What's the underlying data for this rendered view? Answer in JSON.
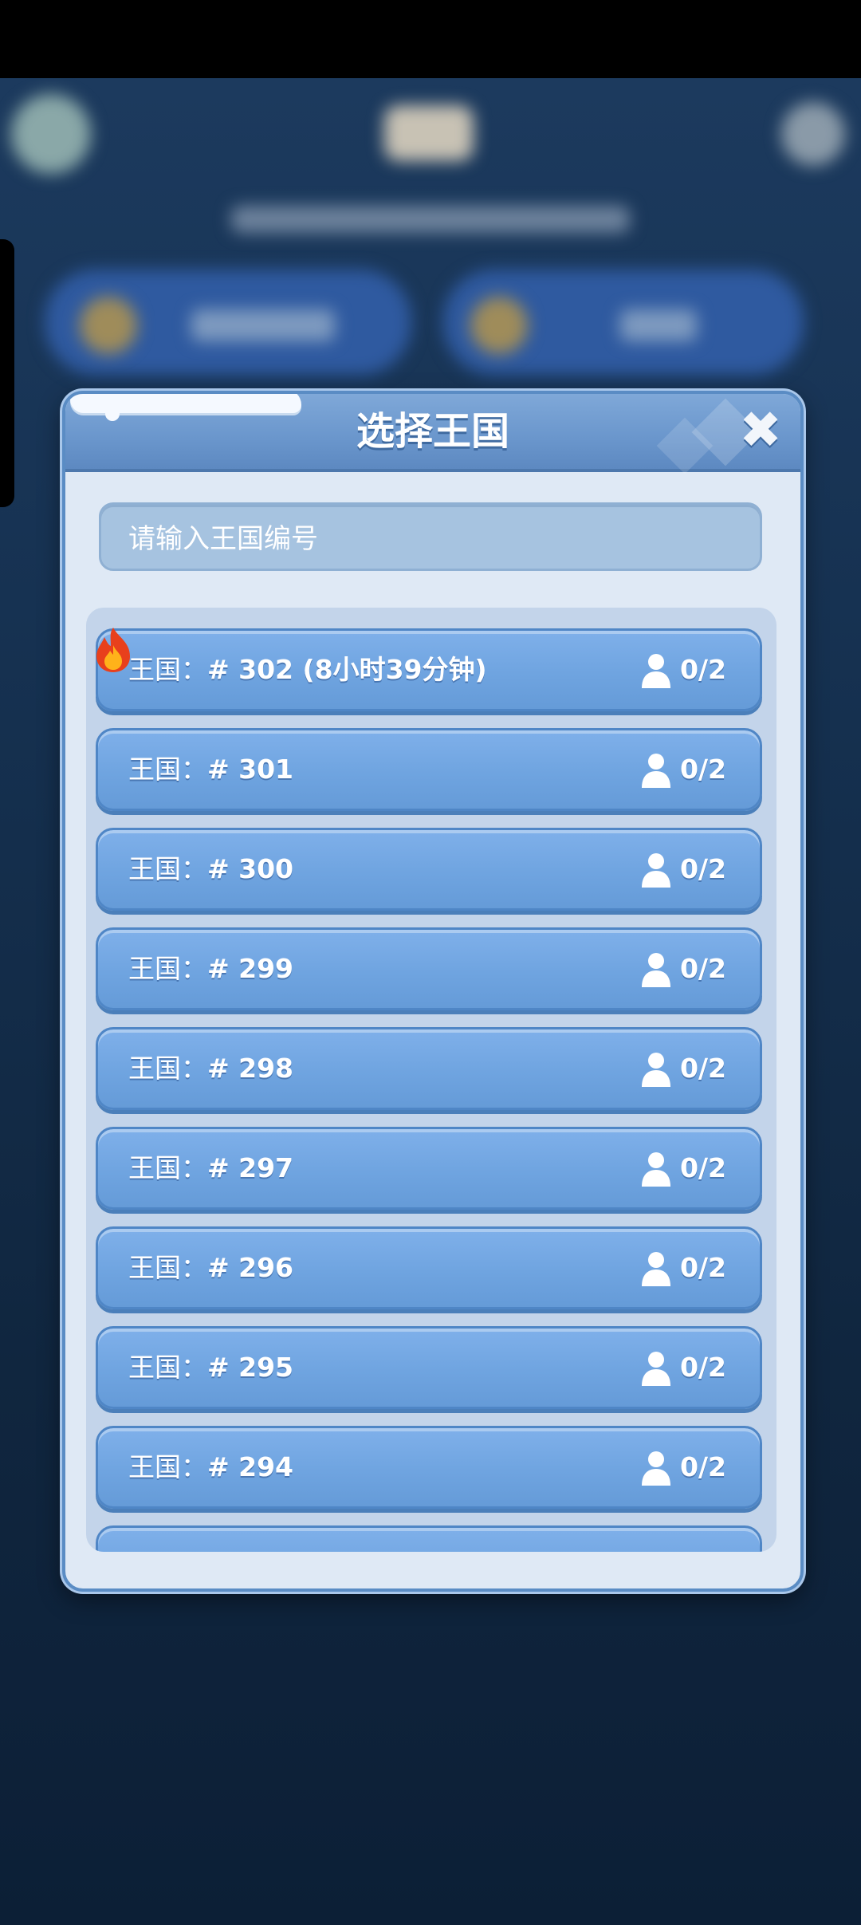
{
  "modal": {
    "title": "选择王国",
    "close_symbol": "✖",
    "search": {
      "placeholder": "请输入王国编号",
      "value": ""
    }
  },
  "kingdoms": [
    {
      "prefix": "王国：",
      "number": "# 302",
      "extra": " (8小时39分钟)",
      "count": "0/2",
      "hot": true
    },
    {
      "prefix": "王国：",
      "number": "# 301",
      "extra": "",
      "count": "0/2",
      "hot": false
    },
    {
      "prefix": "王国：",
      "number": "# 300",
      "extra": "",
      "count": "0/2",
      "hot": false
    },
    {
      "prefix": "王国：",
      "number": "# 299",
      "extra": "",
      "count": "0/2",
      "hot": false
    },
    {
      "prefix": "王国：",
      "number": "# 298",
      "extra": "",
      "count": "0/2",
      "hot": false
    },
    {
      "prefix": "王国：",
      "number": "# 297",
      "extra": "",
      "count": "0/2",
      "hot": false
    },
    {
      "prefix": "王国：",
      "number": "# 296",
      "extra": "",
      "count": "0/2",
      "hot": false
    },
    {
      "prefix": "王国：",
      "number": "# 295",
      "extra": "",
      "count": "0/2",
      "hot": false
    },
    {
      "prefix": "王国：",
      "number": "# 294",
      "extra": "",
      "count": "0/2",
      "hot": false
    }
  ],
  "icons": {
    "hot": "fire-icon",
    "players": "person-icon",
    "close": "close-icon"
  },
  "colors": {
    "row": "#6fa4e0",
    "header": "#6a96cc",
    "panel": "#dfe9f5"
  }
}
